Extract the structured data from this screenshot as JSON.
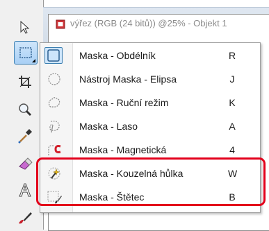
{
  "document": {
    "title": "výřez (RGB (24 bitů)) @25% - Objekt 1"
  },
  "menu": {
    "items": [
      {
        "label": "Maska - Obdélník",
        "shortcut": "R",
        "icon": "rect-mask-icon"
      },
      {
        "label": "Nástroj Maska - Elipsa",
        "shortcut": "J",
        "icon": "ellipse-mask-icon"
      },
      {
        "label": "Maska - Ruční režim",
        "shortcut": "K",
        "icon": "freehand-mask-icon"
      },
      {
        "label": "Maska - Laso",
        "shortcut": "A",
        "icon": "lasso-mask-icon"
      },
      {
        "label": "Maska - Magnetická",
        "shortcut": "4",
        "icon": "magnetic-mask-icon"
      },
      {
        "label": "Maska - Kouzelná hůlka",
        "shortcut": "W",
        "icon": "magic-wand-mask-icon"
      },
      {
        "label": "Maska - Štětec",
        "shortcut": "B",
        "icon": "brush-mask-icon"
      }
    ],
    "selected_index": 0
  },
  "toolbox": {
    "tools": [
      "pick-tool-icon",
      "mask-tool-icon",
      "crop-tool-icon",
      "zoom-tool-icon",
      "eyedropper-tool-icon",
      "eraser-tool-icon",
      "text-tool-icon",
      "brush-tool-icon"
    ]
  },
  "colors": {
    "highlight": "#e3001b",
    "selection": "#3c7fb1"
  }
}
